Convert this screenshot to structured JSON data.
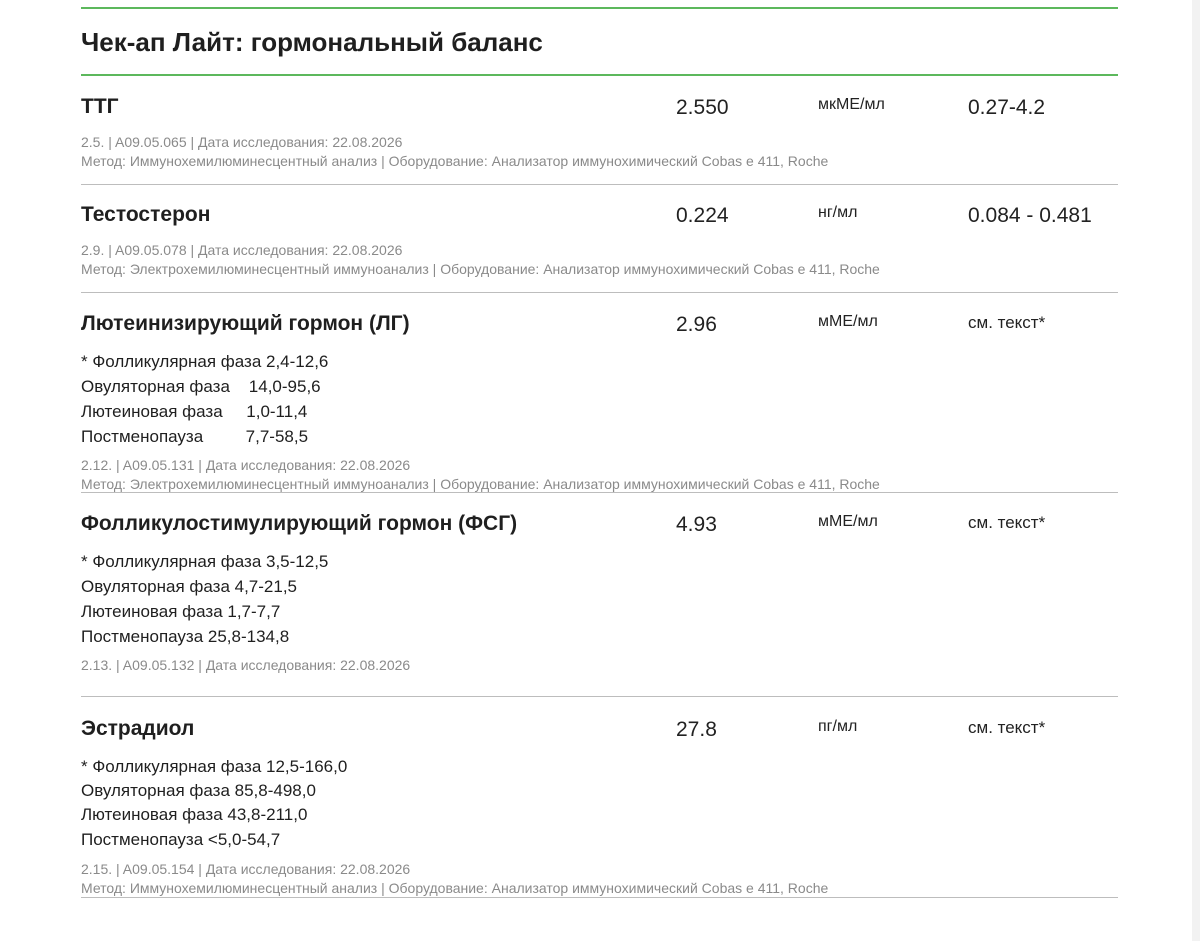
{
  "title": "Чек-ап Лайт: гормональный баланс",
  "tests": [
    {
      "name": "ТТГ",
      "value": "2.550",
      "unit": "мкМЕ/мл",
      "ref": "0.27-4.2",
      "code_line": "2.5. | A09.05.065 | Дата исследования: 22.08.2026",
      "method_line": "Метод: Иммунохемилюминесцентный анализ | Оборудование: Анализатор иммунохимический Cobas e 411, Roche"
    },
    {
      "name": "Тестостерон",
      "value": "0.224",
      "unit": "нг/мл",
      "ref": "0.084 - 0.481",
      "code_line": "2.9. | A09.05.078 | Дата исследования: 22.08.2026",
      "method_line": "Метод: Электрохемилюминесцентный иммуноанализ | Оборудование: Анализатор иммунохимический Cobas e 411, Roche"
    },
    {
      "name": "Лютеинизирующий гормон (ЛГ)",
      "value": "2.96",
      "unit": "мМЕ/мл",
      "ref": "см. текст*",
      "notes": [
        "* Фолликулярная фаза 2,4-12,6",
        "Овуляторная фаза    14,0-95,6",
        "Лютеиновая фаза     1,0-11,4",
        "Постменопауза         7,7-58,5"
      ],
      "code_line": "2.12. | A09.05.131 | Дата исследования: 22.08.2026",
      "method_line": "Метод: Электрохемилюминесцентный иммуноанализ | Оборудование: Анализатор иммунохимический Cobas e 411, Roche"
    },
    {
      "name": "Фолликулостимулирующий гормон (ФСГ)",
      "value": "4.93",
      "unit": "мМЕ/мл",
      "ref": "см. текст*",
      "notes": [
        "* Фолликулярная фаза 3,5-12,5",
        "Овуляторная фаза 4,7-21,5",
        "Лютеиновая фаза 1,7-7,7",
        "Постменопауза 25,8-134,8"
      ],
      "code_line": "2.13. | A09.05.132 | Дата исследования: 22.08.2026"
    },
    {
      "name": "Эстрадиол",
      "value": "27.8",
      "unit": "пг/мл",
      "ref": "см. текст*",
      "notes": [
        "* Фолликулярная фаза 12,5-166,0",
        "Овуляторная фаза 85,8-498,0",
        "Лютеиновая фаза 43,8-211,0",
        "Постменопауза <5,0-54,7"
      ],
      "code_line": "2.15. | A09.05.154 | Дата исследования: 22.08.2026",
      "method_line": "Метод: Иммунохемилюминесцентный анализ | Оборудование: Анализатор иммунохимический Cobas e 411, Roche"
    }
  ]
}
